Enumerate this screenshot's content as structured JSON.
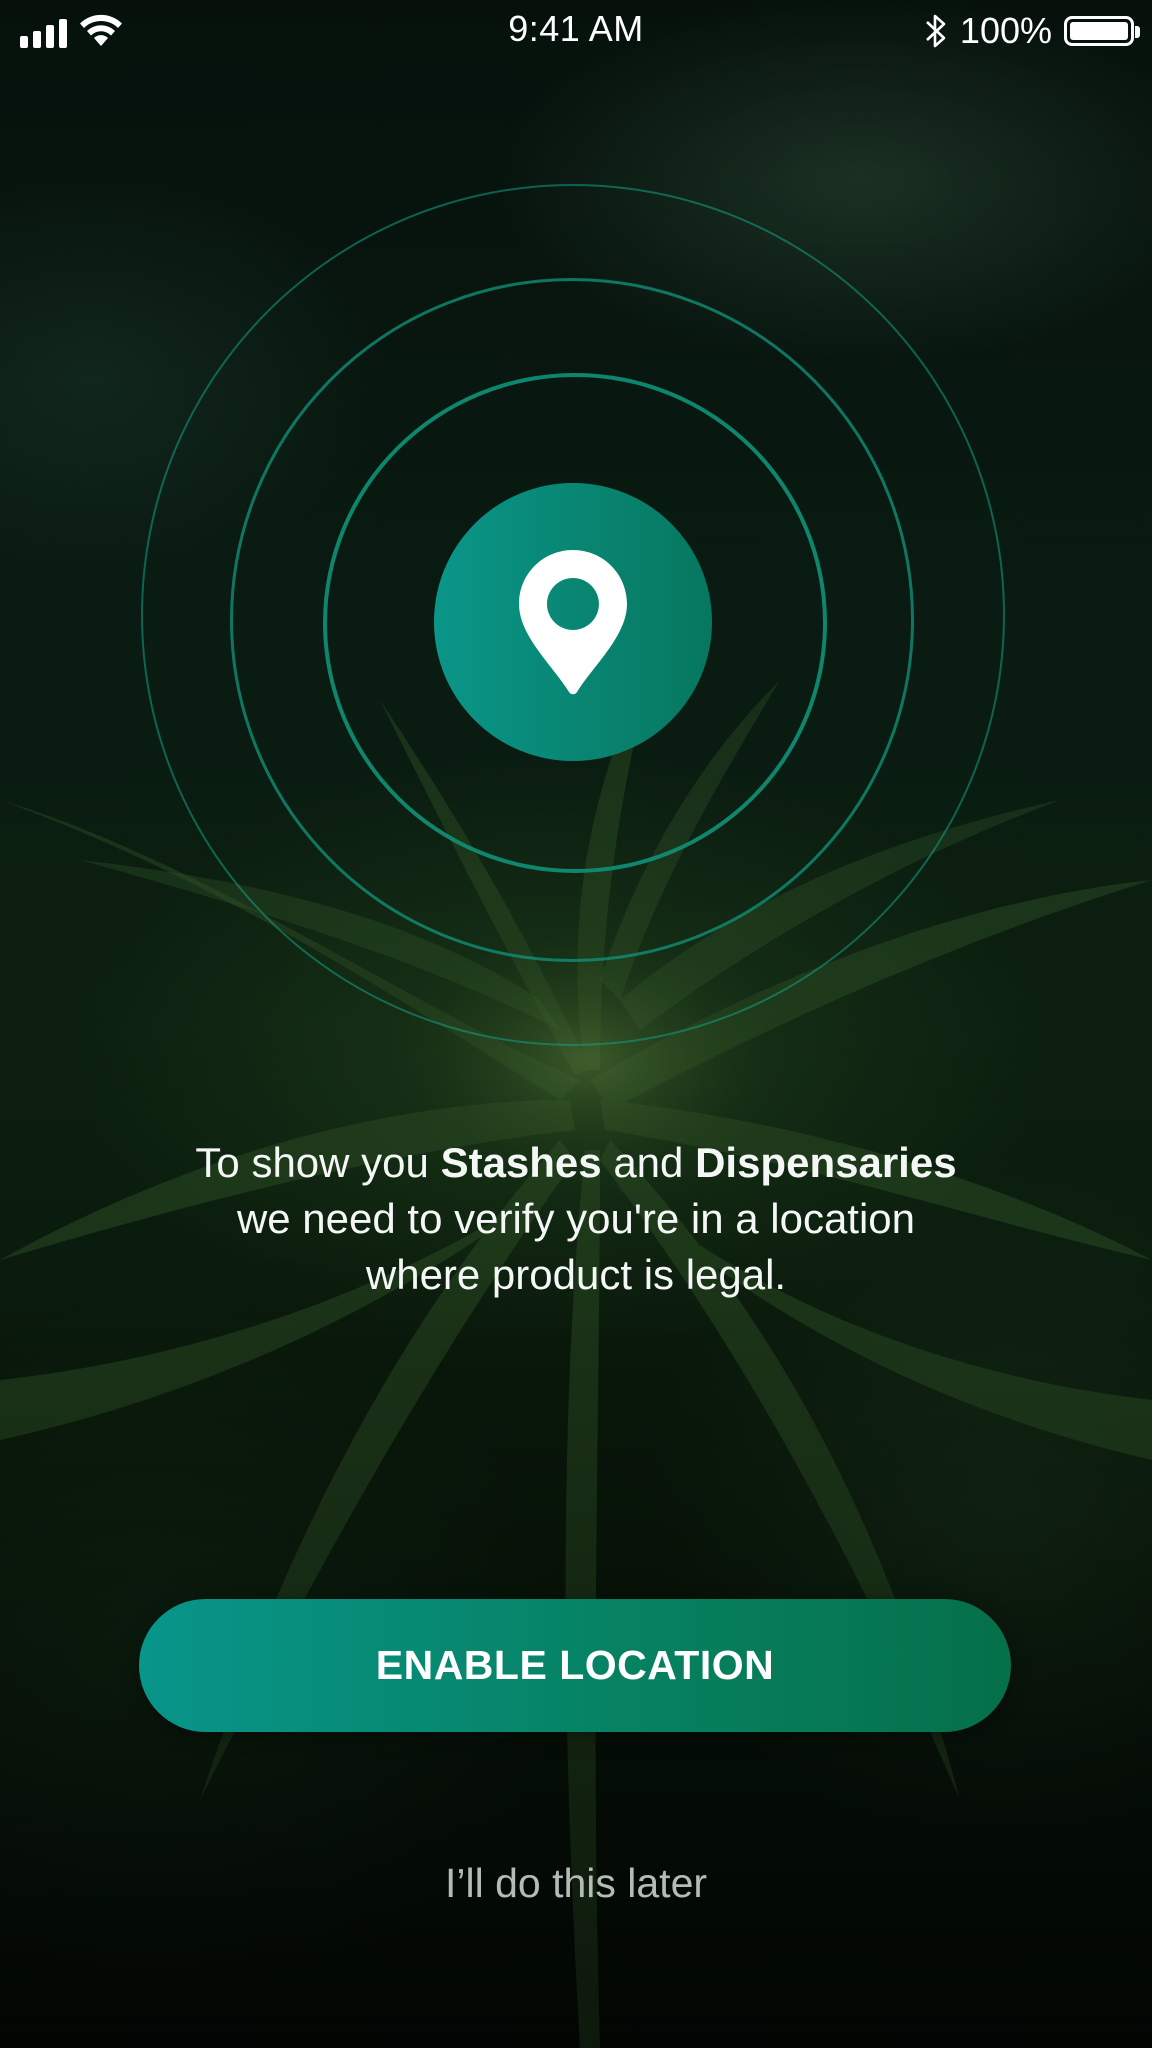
{
  "status_bar": {
    "signal_icon": "cellular-signal-icon",
    "wifi_icon": "wifi-icon",
    "time": "9:41 AM",
    "bluetooth_icon": "bluetooth-icon",
    "battery_percent": "100%",
    "battery_icon": "battery-icon",
    "battery_level": 1.0
  },
  "hero": {
    "icon": "location-pin-icon",
    "accent_color": "#0a9688",
    "ring_color": "#12a087"
  },
  "message": {
    "part1": "To  show you ",
    "stashes": "Stashes",
    "part2": "  and  ",
    "dispensaries": "Dispensaries",
    "line2": "we need to verify you're in a location",
    "line3": "where product is legal."
  },
  "actions": {
    "enable_label": "ENABLE LOCATION",
    "later_label": "I’ll do this later"
  }
}
